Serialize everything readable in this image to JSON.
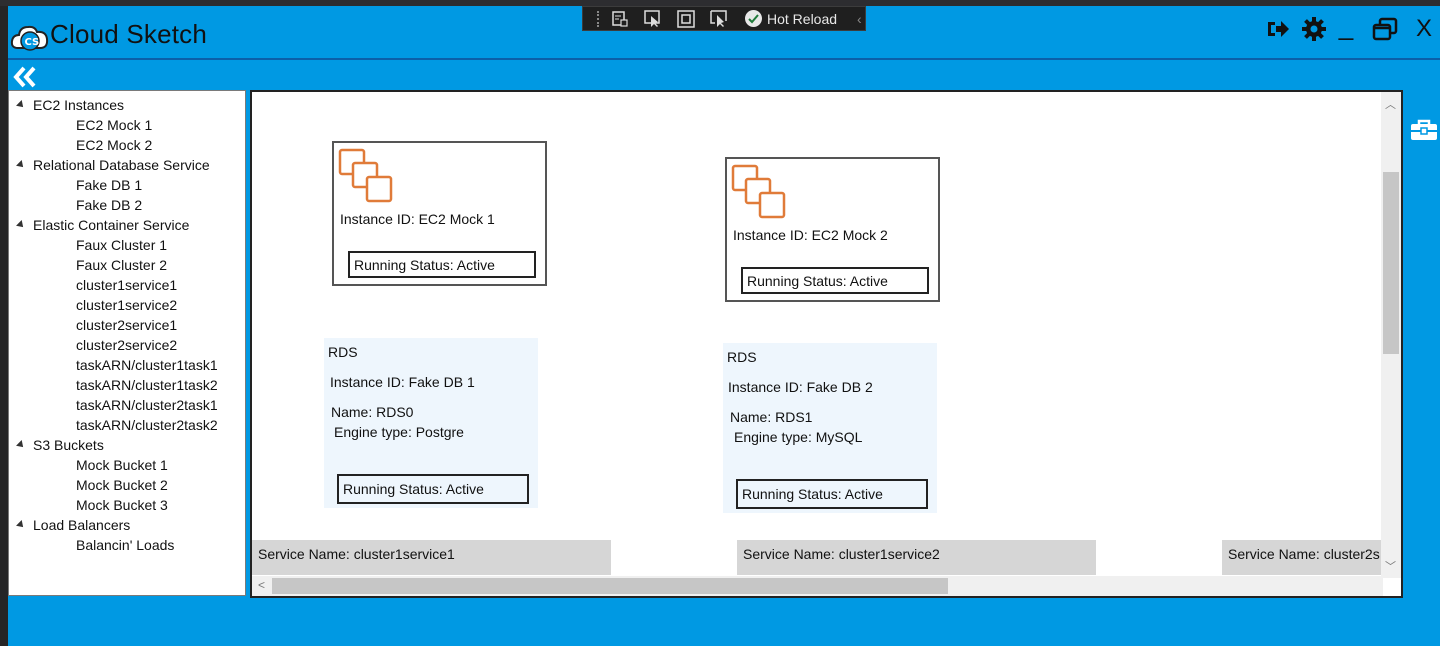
{
  "app": {
    "title": "Cloud Sketch"
  },
  "devtools": {
    "hot_reload_label": "Hot Reload"
  },
  "window_controls": {
    "minimize": "_",
    "close": "X"
  },
  "tree": {
    "groups": [
      {
        "label": "EC2 Instances",
        "items": [
          "EC2 Mock 1",
          "EC2 Mock 2"
        ]
      },
      {
        "label": "Relational Database Service",
        "items": [
          "Fake DB 1",
          "Fake DB 2"
        ]
      },
      {
        "label": "Elastic Container Service",
        "items": [
          "Faux Cluster 1",
          "Faux Cluster 2",
          "cluster1service1",
          "cluster1service2",
          "cluster2service1",
          "cluster2service2",
          "taskARN/cluster1task1",
          "taskARN/cluster1task2",
          "taskARN/cluster2task1",
          "taskARN/cluster2task2"
        ]
      },
      {
        "label": "S3 Buckets",
        "items": [
          "Mock Bucket 1",
          "Mock Bucket 2",
          "Mock Bucket 3"
        ]
      },
      {
        "label": "Load Balancers",
        "items": [
          "Balancin' Loads"
        ]
      }
    ]
  },
  "ec2_cards": [
    {
      "instance": "Instance ID: EC2 Mock 1",
      "status": "Running Status: Active"
    },
    {
      "instance": "Instance ID: EC2 Mock 2",
      "status": "Running Status: Active"
    }
  ],
  "rds_cards": [
    {
      "heading": "RDS",
      "instance": "Instance ID: Fake DB 1",
      "name": "Name: RDS0",
      "engine": "Engine type: Postgre",
      "status": "Running Status: Active"
    },
    {
      "heading": "RDS",
      "instance": "Instance ID: Fake DB 2",
      "name": "Name: RDS1",
      "engine": "Engine type: MySQL",
      "status": "Running Status: Active"
    }
  ],
  "services": [
    "Service Name: cluster1service1",
    "Service Name: cluster1service2",
    "Service Name: cluster2s"
  ],
  "colors": {
    "app_background": "#0099e3",
    "ec2_icon": "#e07b39",
    "rds_background": "#eef6fd",
    "service_bar": "#d6d6d6"
  }
}
